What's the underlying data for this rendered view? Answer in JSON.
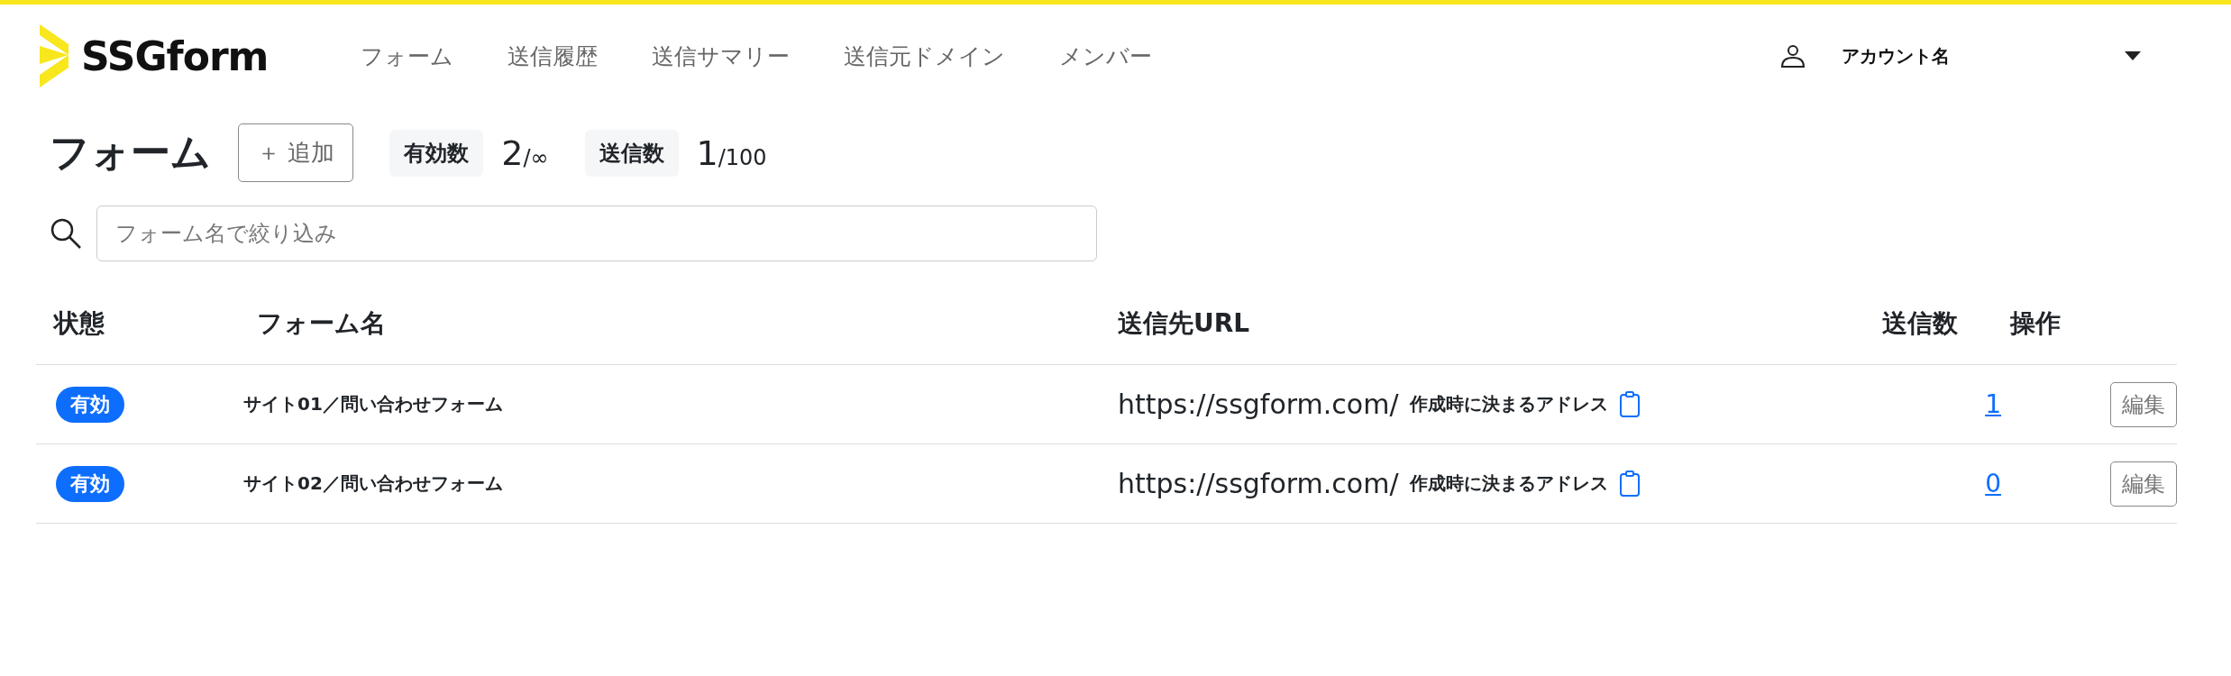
{
  "header": {
    "logo": "SSGform",
    "nav": [
      {
        "label": "フォーム"
      },
      {
        "label": "送信履歴"
      },
      {
        "label": "送信サマリー"
      },
      {
        "label": "送信元ドメイン"
      },
      {
        "label": "メンバー"
      }
    ],
    "account": "アカウント名"
  },
  "page": {
    "title": "フォーム",
    "add_button": "＋ 追加",
    "stats": [
      {
        "label": "有効数",
        "value": "2",
        "limit": "/∞"
      },
      {
        "label": "送信数",
        "value": "1",
        "limit": "/100"
      }
    ]
  },
  "search": {
    "placeholder": "フォーム名で絞り込み"
  },
  "table": {
    "columns": [
      "状態",
      "フォーム名",
      "送信先URL",
      "送信数",
      "操作"
    ],
    "rows": [
      {
        "status": "有効",
        "active": true,
        "name": "サイト01／問い合わせフォーム",
        "url": "https://ssgform.com/",
        "url_note": "作成時に決まるアドレス",
        "count": "1",
        "action": "編集"
      },
      {
        "status": "有効",
        "active": true,
        "name": "サイト02／問い合わせフォーム",
        "url": "https://ssgform.com/",
        "url_note": "作成時に決まるアドレス",
        "count": "0",
        "action": "編集"
      }
    ]
  }
}
